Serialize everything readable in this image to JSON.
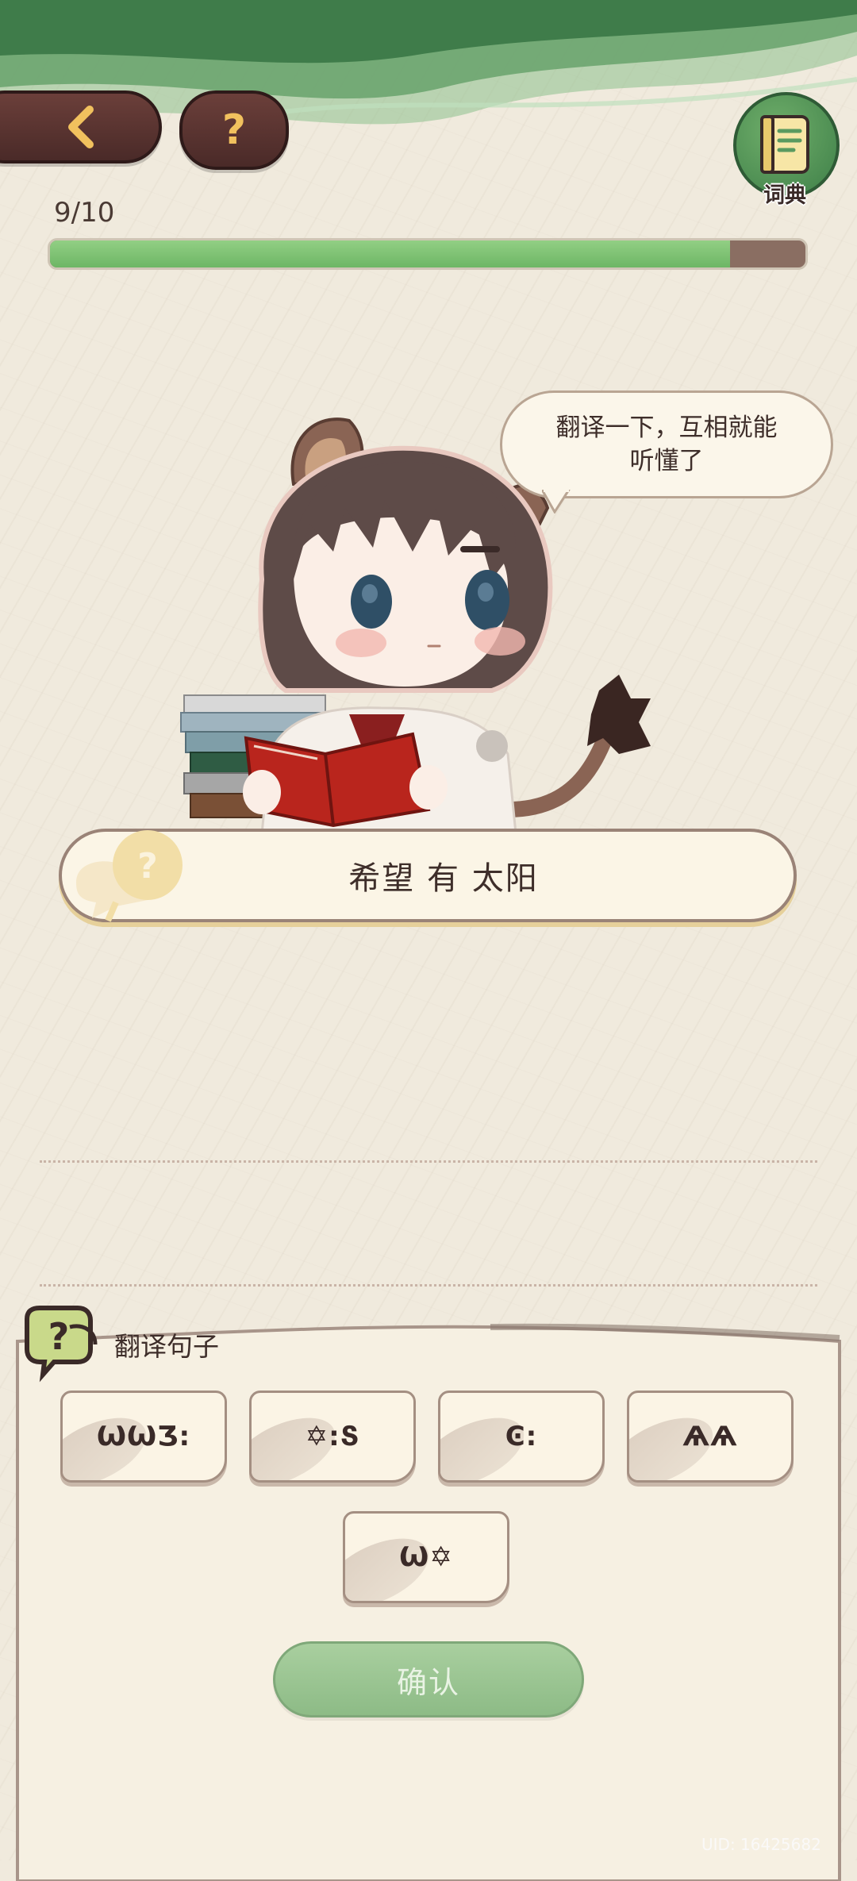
{
  "header": {
    "help_label": "?",
    "dictionary_label": "词典"
  },
  "progress": {
    "text": "9/10",
    "current": 9,
    "total": 10
  },
  "speech_bubble": {
    "line1": "翻译一下，互相就能",
    "line2": "听懂了"
  },
  "sentence": {
    "text": "希望 有 太阳"
  },
  "translate_section": {
    "title": "翻译句子",
    "tiles": [
      "ѠѠƷ:",
      "✡:Տ",
      "Ͼ:",
      "ѦѦ",
      "Ѡ✡"
    ]
  },
  "confirm_label": "确认",
  "uid": "UID: 16425682",
  "colors": {
    "accent_green": "#6db665",
    "panel_border": "#9a8377",
    "background": "#f0eadd"
  }
}
